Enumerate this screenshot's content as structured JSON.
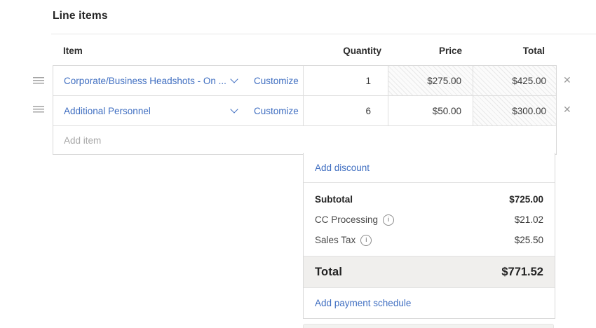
{
  "page": {
    "title": "Line items"
  },
  "table": {
    "headers": {
      "item": "Item",
      "quantity": "Quantity",
      "price": "Price",
      "total": "Total"
    },
    "rows": [
      {
        "item": "Corporate/Business Headshots - On ...",
        "customize": "Customize",
        "quantity": "1",
        "price": "$275.00",
        "total": "$425.00"
      },
      {
        "item": "Additional Personnel",
        "customize": "Customize",
        "quantity": "6",
        "price": "$50.00",
        "total": "$300.00"
      }
    ],
    "add_item_placeholder": "Add item",
    "remove_row_icon": "close-x",
    "reorder_icon": "drag-handle"
  },
  "summary": {
    "add_discount": "Add discount",
    "subtotal_label": "Subtotal",
    "subtotal_value": "$725.00",
    "cc_processing_label": "CC Processing",
    "cc_processing_value": "$21.02",
    "sales_tax_label": "Sales Tax",
    "sales_tax_value": "$25.50",
    "info_icon_glyph": "i",
    "total_label": "Total",
    "total_value": "$771.52",
    "add_payment_schedule": "Add payment schedule"
  },
  "colors": {
    "link_blue": "#3f6ec1",
    "border_gray": "#d9d9d9",
    "total_row_bg": "#f0efed",
    "hatch_stripe": "#e9e9e9",
    "title_text": "#232323"
  }
}
